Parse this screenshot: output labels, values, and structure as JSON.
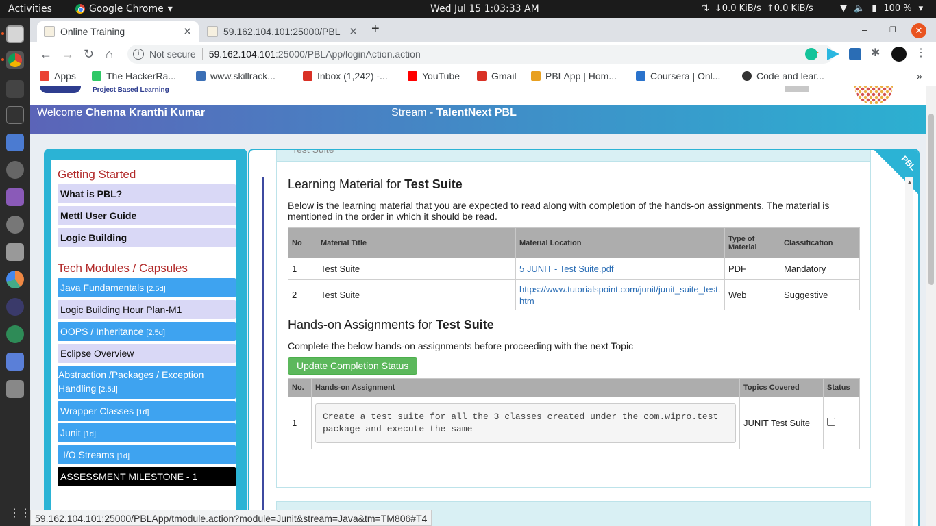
{
  "topbar": {
    "activities": "Activities",
    "app_name": "Google Chrome",
    "clock": "Wed Jul 15   1:03:33 AM",
    "net_down": "↓0.0 KiB/s",
    "net_up": "↑0.0 KiB/s",
    "battery": "100 %"
  },
  "browser": {
    "tabs": [
      {
        "label": "Online Training"
      },
      {
        "label": "59.162.104.101:25000/PBL"
      }
    ],
    "omnibox": {
      "security": "Not secure",
      "url_host": "59.162.104.101",
      "url_rest": ":25000/PBLApp/loginAction.action"
    },
    "bookmarks": [
      {
        "label": "Apps",
        "color": "#ea4335"
      },
      {
        "label": "The HackerRa...",
        "color": "#2ec866"
      },
      {
        "label": "www.skillrack...",
        "color": "#3b6fb6"
      },
      {
        "label": "Inbox (1,242) -...",
        "color": "#d93025"
      },
      {
        "label": "YouTube",
        "color": "#ff0000"
      },
      {
        "label": "Gmail",
        "color": "#d93025"
      },
      {
        "label": "PBLApp | Hom...",
        "color": "#e8a020"
      },
      {
        "label": "Coursera | Onl...",
        "color": "#2a73cc"
      },
      {
        "label": "Code and lear...",
        "color": "#333333"
      }
    ],
    "status_url": "59.162.104.101:25000/PBLApp/tmodule.action?module=Junit&stream=Java&tm=TM806#T4"
  },
  "page": {
    "tagline": "Project Based Learning",
    "welcome_prefix": "Welcome ",
    "welcome_name": "Chenna Kranthi Kumar",
    "stream_prefix": "Stream - ",
    "stream_name": "TalentNext PBL",
    "ribbon": "PBL"
  },
  "sidebar": {
    "getting_started_title": "Getting Started",
    "getting_started": [
      {
        "label": "What is PBL?"
      },
      {
        "label": "Mettl User Guide"
      },
      {
        "label": "Logic Building"
      }
    ],
    "tech_title": "Tech Modules / Capsules",
    "modules": [
      {
        "label": "Java Fundamentals",
        "dur": "[2.5d]",
        "style": "blue"
      },
      {
        "label": "Logic Building Hour Plan-M1",
        "dur": "",
        "style": "lav"
      },
      {
        "label": "OOPS / Inheritance",
        "dur": "[2.5d]",
        "style": "blue"
      },
      {
        "label": "Eclipse Overview",
        "dur": "",
        "style": "lav"
      },
      {
        "label": "Abstraction /Packages / Exception Handling",
        "dur": "[2.5d]",
        "style": "blue"
      },
      {
        "label": "Wrapper Classes",
        "dur": "[1d]",
        "style": "blue"
      },
      {
        "label": "Junit",
        "dur": "[1d]",
        "style": "blue"
      },
      {
        "label": "I/O Streams",
        "dur": "[1d]",
        "style": "blue"
      },
      {
        "label": "ASSESSMENT MILESTONE - 1",
        "dur": "",
        "style": "black"
      }
    ]
  },
  "topic": {
    "header": "Test Suite",
    "learning_prefix": "Learning Material for ",
    "learning_topic": "Test Suite",
    "learning_desc": "Below is the learning material that you are expected to read along with completion of the hands-on assignments. The material is mentioned in the order in which it should be read.",
    "material_headers": {
      "no": "No",
      "title": "Material Title",
      "location": "Material Location",
      "type": "Type of Material",
      "classification": "Classification"
    },
    "materials": [
      {
        "no": "1",
        "title": "Test Suite",
        "location": "5 JUNIT - Test Suite.pdf",
        "type": "PDF",
        "classification": "Mandatory"
      },
      {
        "no": "2",
        "title": "Test Suite",
        "location": "https://www.tutorialspoint.com/junit/junit_suite_test.htm",
        "type": "Web",
        "classification": "Suggestive"
      }
    ],
    "handson_prefix": "Hands-on Assignments for ",
    "handson_topic": "Test Suite",
    "handson_desc": "Complete the below hands-on assignments before proceeding with the next Topic",
    "update_button": "Update Completion Status",
    "assign_headers": {
      "no": "No.",
      "assignment": "Hands-on Assignment",
      "topics": "Topics Covered",
      "status": "Status"
    },
    "assignments": [
      {
        "no": "1",
        "text": " Create a test suite for all the 3 classes created under the com.wipro.test package  and execute the same",
        "topics": "JUNIT Test Suite",
        "checked": false
      }
    ]
  }
}
